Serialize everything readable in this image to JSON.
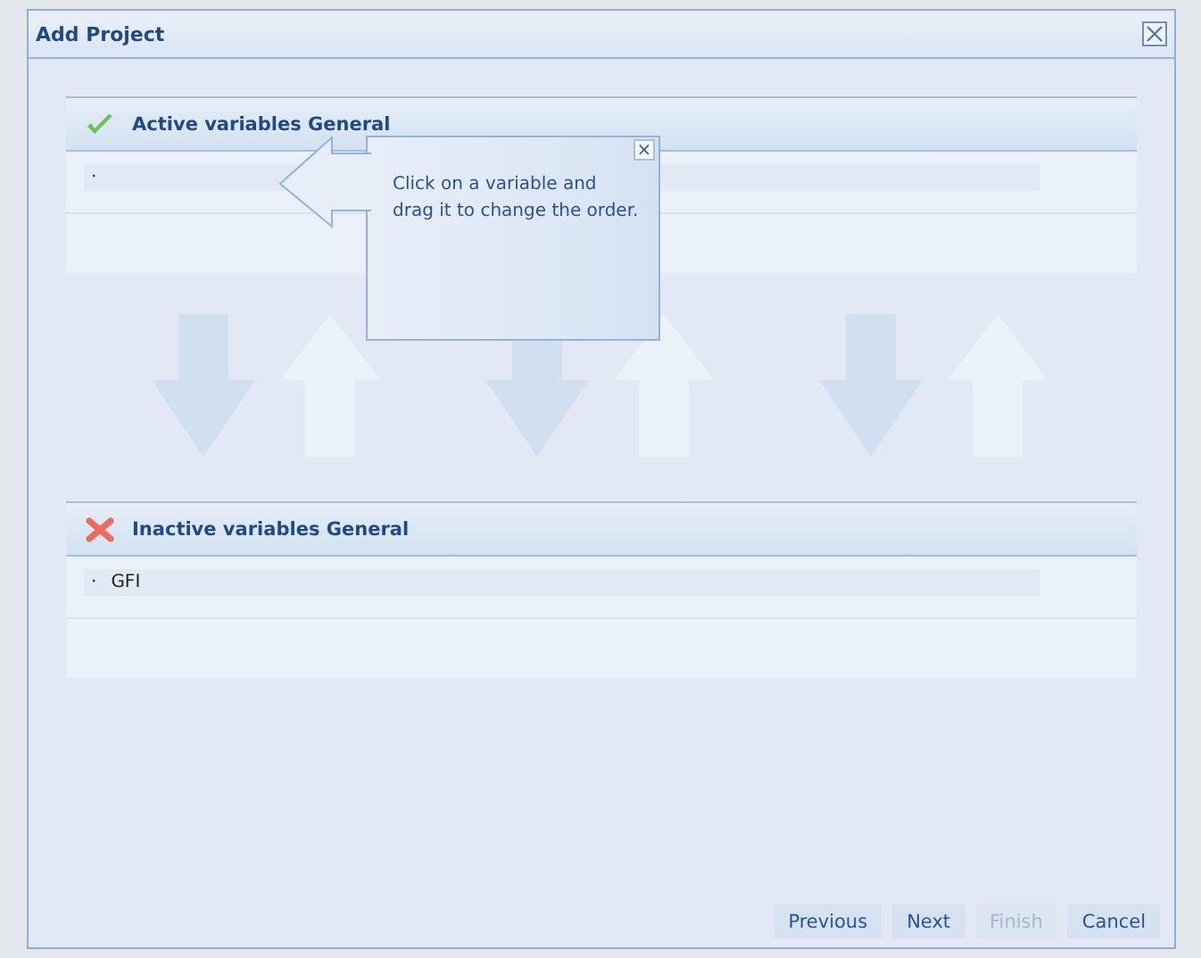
{
  "window": {
    "title": "Add Project"
  },
  "panels": [
    {
      "kind": "active",
      "title": "Active variables General",
      "items": [
        {
          "bullet": "·"
        }
      ]
    },
    {
      "kind": "inactive",
      "title": "Inactive variables General",
      "items": [
        {
          "bullet": "·",
          "label": "GFI"
        }
      ]
    }
  ],
  "tooltip": {
    "text": "Click on a variable and drag it to change the order.",
    "close": "×"
  },
  "buttons": [
    {
      "label": "Previous",
      "disabled": false
    },
    {
      "label": "Next",
      "disabled": false
    },
    {
      "label": "Finish",
      "disabled": true
    },
    {
      "label": "Cancel",
      "disabled": false
    }
  ]
}
